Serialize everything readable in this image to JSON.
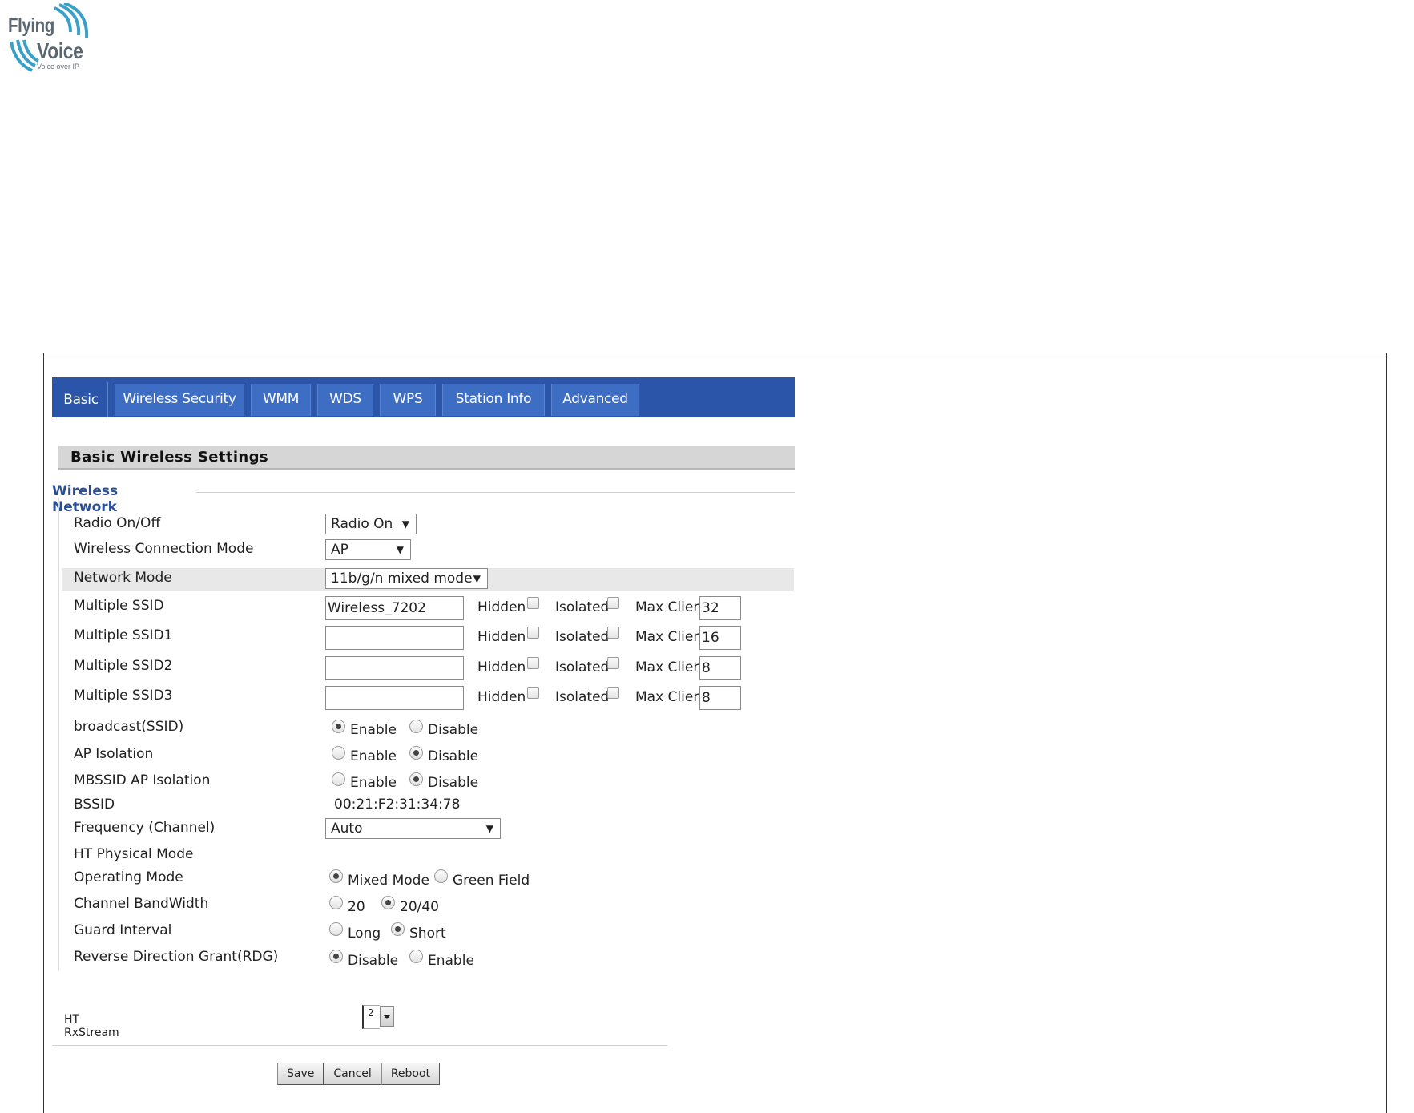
{
  "logo": {
    "word1": "Flying",
    "word2": "Voice",
    "tagline": "Voice over IP"
  },
  "tabs": [
    "Basic",
    "Wireless Security",
    "WMM",
    "WDS",
    "WPS",
    "Station Info",
    "Advanced"
  ],
  "active_tab": "Basic",
  "section_title": "Basic Wireless Settings",
  "fieldset_legend": "Wireless Network",
  "fields": {
    "radio": {
      "label": "Radio On/Off",
      "value": "Radio On"
    },
    "conn_mode": {
      "label": "Wireless Connection Mode",
      "value": "AP"
    },
    "net_mode": {
      "label": "Network Mode",
      "value": "11b/g/n mixed mode"
    },
    "ssids": [
      {
        "label": "Multiple SSID",
        "value": "Wireless_7202",
        "max_client": "32"
      },
      {
        "label": "Multiple SSID1",
        "value": "",
        "max_client": "16"
      },
      {
        "label": "Multiple SSID2",
        "value": "",
        "max_client": "8"
      },
      {
        "label": "Multiple SSID3",
        "value": "",
        "max_client": "8"
      }
    ],
    "ssid_opts": {
      "hidden": "Hidden",
      "isolated": "Isolated",
      "max_client": "Max Client"
    },
    "broadcast": {
      "label": "broadcast(SSID)",
      "opt1": "Enable",
      "opt2": "Disable",
      "selected": "Enable"
    },
    "ap_iso": {
      "label": "AP Isolation",
      "opt1": "Enable",
      "opt2": "Disable",
      "selected": "Disable"
    },
    "mbssid_iso": {
      "label": "MBSSID AP Isolation",
      "opt1": "Enable",
      "opt2": "Disable",
      "selected": "Disable"
    },
    "bssid": {
      "label": "BSSID",
      "value": "00:21:F2:31:34:78"
    },
    "freq": {
      "label": "Frequency (Channel)",
      "value": "Auto"
    },
    "ht_phys": {
      "label": "HT Physical Mode"
    },
    "op_mode": {
      "label": "Operating Mode",
      "opt1": "Mixed Mode",
      "opt2": "Green Field",
      "selected": "Mixed Mode"
    },
    "bandwidth": {
      "label": "Channel BandWidth",
      "opt1": "20",
      "opt2": "20/40",
      "selected": "20/40"
    },
    "guard": {
      "label": "Guard Interval",
      "opt1": "Long",
      "opt2": "Short",
      "selected": "Short"
    },
    "rdg": {
      "label": "Reverse Direction Grant(RDG)",
      "opt1": "Disable",
      "opt2": "Enable",
      "selected": "Disable"
    },
    "ht_rx": {
      "label": "HT RxStream",
      "value": "2"
    }
  },
  "buttons": {
    "save": "Save",
    "cancel": "Cancel",
    "reboot": "Reboot"
  },
  "colors": {
    "tab_bar": "#2b55a8",
    "tab": "#3e6dc4",
    "legend": "#2a4f96",
    "section_bar": "#d6d6d6"
  }
}
